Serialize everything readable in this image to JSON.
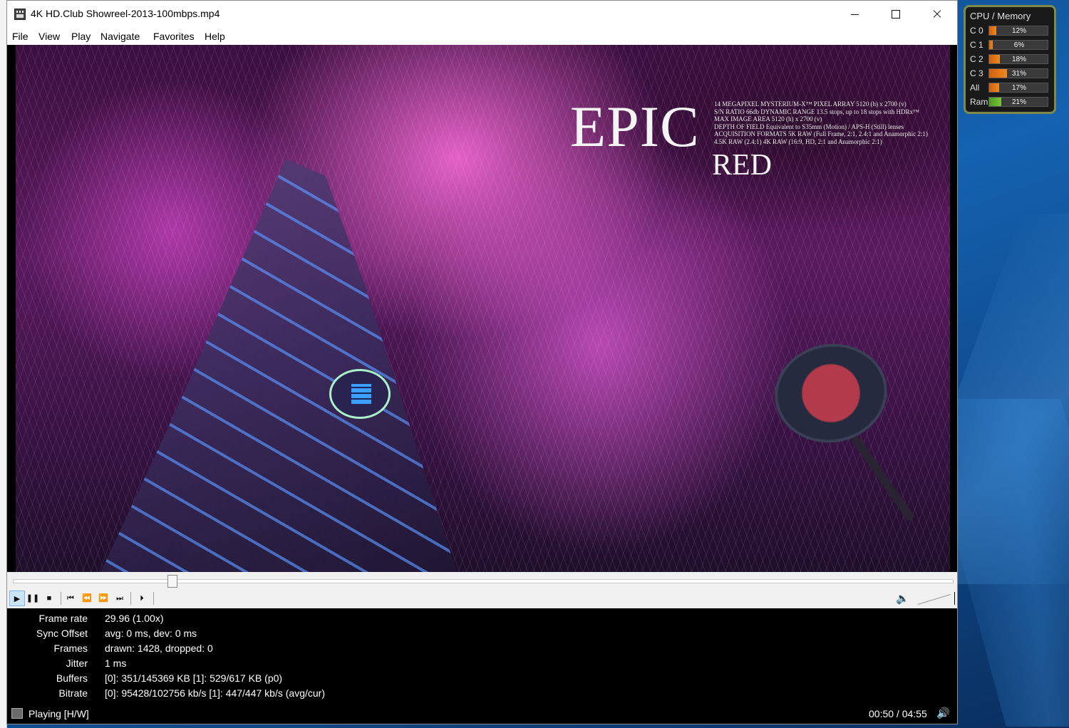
{
  "window": {
    "title": "4K HD.Club Showreel-2013-100mbps.mp4"
  },
  "menu": [
    "File",
    "View",
    "Play",
    "Navigate",
    "Favorites",
    "Help"
  ],
  "video": {
    "overlay_title": "EPIC",
    "overlay_subtitle": "RED",
    "specs": [
      "14 MEGAPIXEL MYSTERIUM-X™ PIXEL ARRAY 5120 (h) x 2700 (v)",
      "S/N RATIO 66db DYNAMIC RANGE 13.5 stops, up to 18 stops with HDRx™",
      "MAX IMAGE AREA    5120 (h) x 2700 (v)",
      "DEPTH OF FIELD  Equivalent to S35mm (Motion) / APS-H (Still) lenses",
      "ACQUISITION FORMATS     5K RAW (Full Frame, 2:1, 2.4:1 and Anamorphic 2:1)",
      "4.5K RAW (2.4:1)  4K RAW (16:9, HD, 2:1 and Anamorphic 2:1)"
    ]
  },
  "seek": {
    "position_fraction": 0.17
  },
  "controls": {
    "buttons": [
      {
        "name": "play-button",
        "glyph": "▶"
      },
      {
        "name": "pause-button",
        "glyph": "❚❚"
      },
      {
        "name": "stop-button",
        "glyph": "■"
      },
      {
        "name": "previous-button",
        "glyph": "⏮"
      },
      {
        "name": "rewind-button",
        "glyph": "⏪"
      },
      {
        "name": "fast-forward-button",
        "glyph": "⏩"
      },
      {
        "name": "next-button",
        "glyph": "⏭"
      },
      {
        "name": "frame-step-button",
        "glyph": "⏵"
      }
    ],
    "volume_icon": "speaker-icon",
    "volume_fraction": 1.0
  },
  "stats": [
    {
      "label": "Frame rate",
      "value": "29.96 (1.00x)"
    },
    {
      "label": "Sync Offset",
      "value": "avg: 0 ms, dev: 0 ms"
    },
    {
      "label": "Frames",
      "value": "drawn: 1428, dropped: 0"
    },
    {
      "label": "Jitter",
      "value": "1 ms"
    },
    {
      "label": "Buffers",
      "value": "[0]: 351/145369 KB [1]: 529/617 KB (p0)"
    },
    {
      "label": "Bitrate",
      "value": "[0]: 95428/102756 kb/s [1]: 447/447 kb/s (avg/cur)"
    }
  ],
  "status": {
    "state": "Playing [H/W]",
    "time": "00:50 / 04:55"
  },
  "cpu_meter": {
    "title": "CPU / Memory",
    "rows": [
      {
        "label": "C 0",
        "value": "12%",
        "percent": 12,
        "kind": "cpu"
      },
      {
        "label": "C 1",
        "value": "6%",
        "percent": 6,
        "kind": "cpu"
      },
      {
        "label": "C 2",
        "value": "18%",
        "percent": 18,
        "kind": "cpu"
      },
      {
        "label": "C 3",
        "value": "31%",
        "percent": 31,
        "kind": "cpu"
      },
      {
        "label": "All",
        "value": "17%",
        "percent": 17,
        "kind": "cpu"
      },
      {
        "label": "Ram",
        "value": "21%",
        "percent": 21,
        "kind": "ram"
      }
    ]
  },
  "colors": {
    "accent_active": "#cce4f7",
    "cpu_bar": "#f08a20",
    "ram_bar": "#7ac43a"
  }
}
